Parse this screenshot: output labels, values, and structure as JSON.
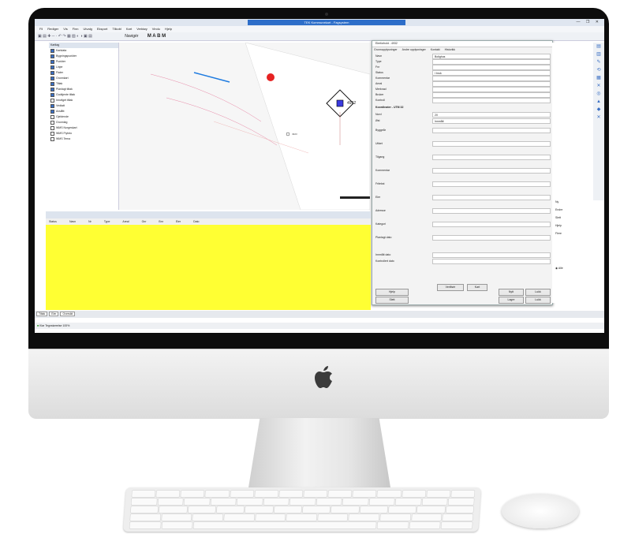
{
  "app": {
    "title": "TEK Kommunekart - Fagsystem",
    "window_buttons": "— ❐ ✕"
  },
  "menu": {
    "items": [
      "Fil",
      "Rediger",
      "Vis",
      "Finn",
      "Utvalg",
      "Eksport",
      "Tilkobl",
      "Kart",
      "Verktøy",
      "Vindu",
      "Hjelp"
    ]
  },
  "toolbar": {
    "navigate_label": "Navigér",
    "mabm_label": "M A B M"
  },
  "layers": {
    "header": "Kartlag",
    "items": [
      {
        "label": "Kartdata",
        "checked": true
      },
      {
        "label": "Bygningspunkter",
        "checked": true
      },
      {
        "label": "Punkter",
        "checked": true
      },
      {
        "label": "Linjer",
        "checked": true
      },
      {
        "label": "Flater",
        "checked": true
      },
      {
        "label": "Grunnkart",
        "checked": true
      },
      {
        "label": "Tiltak",
        "checked": true
      },
      {
        "label": "Planlagt tiltak",
        "checked": true
      },
      {
        "label": "Godkjente tiltak",
        "checked": true
      },
      {
        "label": "Innvilget tiltak",
        "checked": false
      },
      {
        "label": "Vedtatt",
        "checked": true
      },
      {
        "label": "Avslått",
        "checked": true
      },
      {
        "label": "Gjeldende",
        "checked": false
      },
      {
        "label": "Grunnlag",
        "checked": false
      },
      {
        "label": "WMS Norgeskart",
        "checked": false
      },
      {
        "label": "WMS Flyfoto",
        "checked": false
      },
      {
        "label": "WMS Tema",
        "checked": false
      }
    ]
  },
  "map": {
    "label_number": "4932",
    "label_small": "4923"
  },
  "dialog": {
    "title": "Eierforhold - 4932",
    "tabs": [
      "Grunnopplysninger",
      "Andre opplysninger",
      "Kontakt",
      "Historikk"
    ],
    "fields": [
      {
        "label": "Navn",
        "value": "Bolighus"
      },
      {
        "label": "Type",
        "value": ""
      },
      {
        "label": "Fnr",
        "value": ""
      },
      {
        "label": "Status",
        "value": "I bruk"
      },
      {
        "label": "Kommentar",
        "value": ""
      },
      {
        "label": "Areal",
        "value": ""
      },
      {
        "label": "Merknad",
        "value": ""
      },
      {
        "label": "Bruker",
        "value": ""
      },
      {
        "label": "Kontroll",
        "value": ""
      }
    ],
    "section_title": "Koordinater - UTM 32",
    "section_fields": [
      {
        "label": "Nord",
        "value": "20"
      },
      {
        "label": "Øst",
        "value": "Innmålt"
      }
    ],
    "more_labels": [
      "Byggeår",
      "Utført",
      "Tilgang",
      "Kommentar",
      "Fritekst",
      "Eier",
      "Adresse",
      "Kategori",
      "Planlagt dato"
    ],
    "date_row_1": "Innmålt dato",
    "date_row_2": "Kontrollert dato",
    "buttons": {
      "verify": "Verifisér",
      "ok": "Nytt",
      "cancel": "Lukk",
      "delete": "Slett",
      "save": "Lagre",
      "help": "Hjelp",
      "map": "Kart"
    }
  },
  "grid": {
    "columns": [
      "Status",
      "Navn",
      "Nr",
      "Type",
      "Areal",
      "Gnr",
      "Bnr",
      "Eier",
      "Dato"
    ]
  },
  "right_panel": {
    "items": [
      "Ny",
      "Endre",
      "Slett",
      "Hjelp",
      "Flere"
    ],
    "radio_label": "Alle"
  },
  "bottom_tabs": [
    "Tiltak",
    "Eier",
    "Oversikt"
  ],
  "status": {
    "text": "Klar  Tegnstørrelse 100%"
  }
}
